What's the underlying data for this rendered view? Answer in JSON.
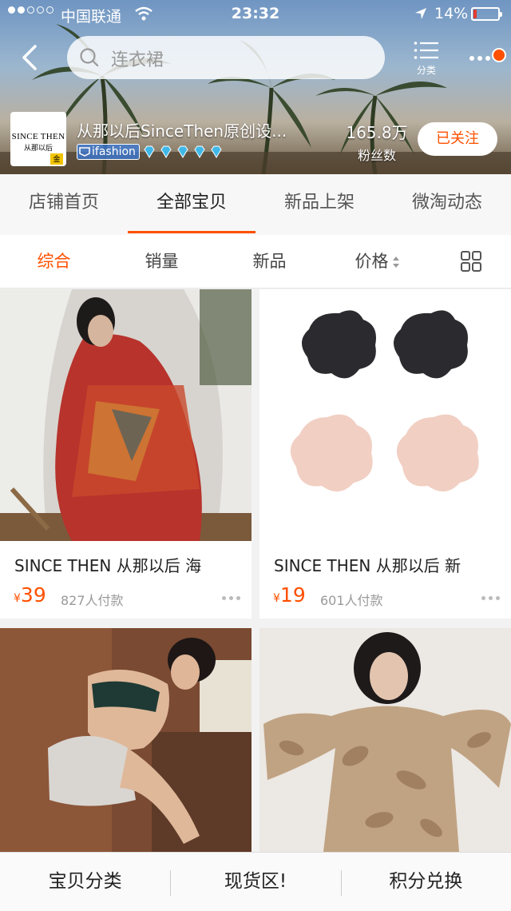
{
  "status_bar": {
    "carrier": "中国联通",
    "time": "23:32",
    "battery": "14%",
    "battery_level": 0.14
  },
  "header": {
    "search_placeholder": "连衣裙",
    "category_label": "分类",
    "shop_name": "从那以后SinceThen原创设...",
    "logo_line1": "SINCE THEN",
    "logo_line2": "从那以后",
    "logo_badge": "金",
    "platform_tag": "ifashion",
    "fans_count": "165.8万",
    "fans_label": "粉丝数",
    "follow_label": "已关注"
  },
  "tabs": [
    "店铺首页",
    "全部宝贝",
    "新品上架",
    "微淘动态"
  ],
  "active_tab": 1,
  "sort_options": [
    "综合",
    "销量",
    "新品",
    "价格"
  ],
  "active_sort": 0,
  "products": [
    {
      "title": "SINCE  THEN 从那以后 海",
      "currency": "¥",
      "price": "39",
      "paid": "827人付款"
    },
    {
      "title": "SINCE THEN 从那以后  新",
      "currency": "¥",
      "price": "19",
      "paid": "601人付款"
    }
  ],
  "bottom_bar": [
    "宝贝分类",
    "现货区!",
    "积分兑换"
  ],
  "colors": {
    "accent": "#ff5000",
    "battery_low": "#e53a2f"
  }
}
